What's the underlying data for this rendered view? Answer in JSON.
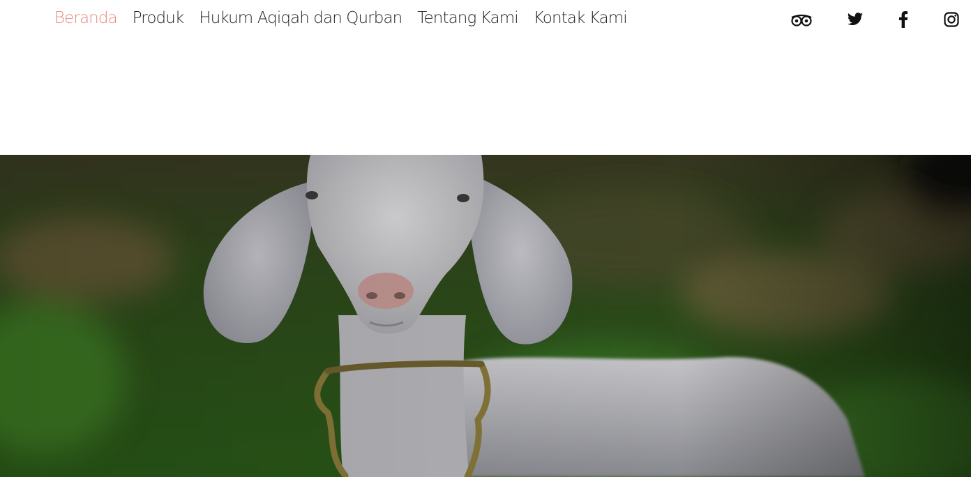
{
  "nav": {
    "items": [
      {
        "label": "Beranda",
        "active": true
      },
      {
        "label": "Produk",
        "active": false
      },
      {
        "label": "Hukum Aqiqah dan Qurban",
        "active": false
      },
      {
        "label": "Tentang Kami",
        "active": false
      },
      {
        "label": "Kontak Kami",
        "active": false
      }
    ],
    "active_color": "#e58a82",
    "text_color": "#222222"
  },
  "social": {
    "icons": [
      "tripadvisor-icon",
      "twitter-icon",
      "facebook-icon",
      "instagram-icon"
    ]
  },
  "hero": {
    "image": "white-goat-photo"
  }
}
